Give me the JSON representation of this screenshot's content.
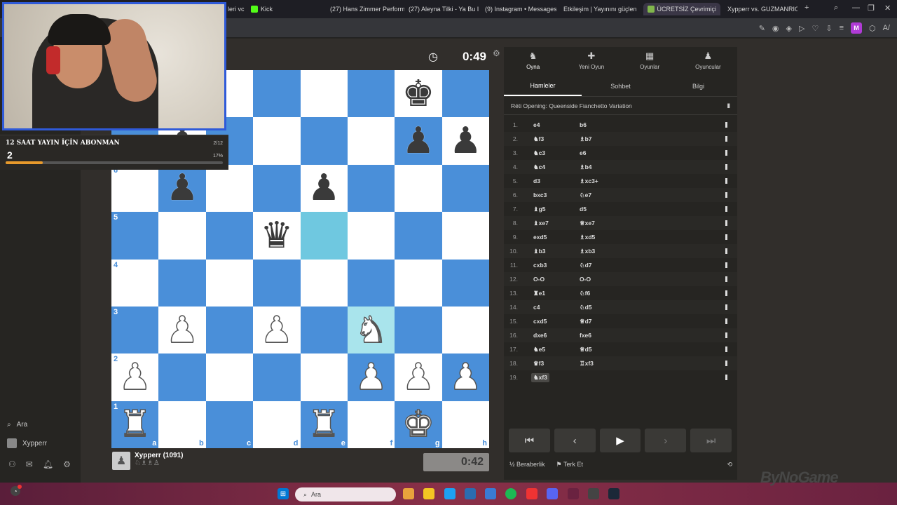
{
  "browser": {
    "tabs": [
      {
        "label": "leri vc",
        "color": "#6b6bff"
      },
      {
        "label": "Kick",
        "color": "#53fc18"
      },
      {
        "label": "(27) Hans Zimmer Perform",
        "color": "#ff0000"
      },
      {
        "label": "(27) Aleyna Tilki - Ya Bu I",
        "color": "#ff0000"
      },
      {
        "label": "(9) Instagram • Messages",
        "color": "#e1306c"
      },
      {
        "label": "Etkileşim | Yayınını güçlen",
        "color": "#ffffff"
      },
      {
        "label": "ÜCRETSİZ Çevrimiçi",
        "color": "#81b64c"
      },
      {
        "label": "Xypperr vs. GUZMANRICA",
        "color": "#81b64c"
      }
    ],
    "profile_initial": "M"
  },
  "stream": {
    "sub_goal_title": "12 SAAT YAYIN İÇİN ABONMAN",
    "sub_goal_count": "2",
    "sub_goal_progress": "2/12",
    "sub_goal_percent": "17%",
    "sub_goal_fraction": 0.17,
    "brand": "ByNoGame"
  },
  "sidebar": {
    "search_label": "Ara",
    "user_label": "Xypperr"
  },
  "game": {
    "top_clock": "0:49",
    "bottom_clock": "0:42",
    "player_name": "Xypperr (1091)",
    "player_captured": "♘♗♗♙",
    "files": [
      "a",
      "b",
      "c",
      "d",
      "e",
      "f",
      "g",
      "h"
    ],
    "ranks": [
      "6",
      "5",
      "4",
      "3",
      "2",
      "1"
    ],
    "board": [
      [
        "",
        "",
        "",
        "",
        "",
        "",
        "bK",
        ""
      ],
      [
        "",
        "bP",
        "",
        "",
        "",
        "",
        "bP",
        "bP"
      ],
      [
        "",
        "bP",
        "",
        "",
        "bP",
        "",
        "",
        ""
      ],
      [
        "",
        "",
        "",
        "bQ",
        "",
        "",
        "",
        ""
      ],
      [
        "",
        "",
        "",
        "",
        "",
        "",
        "",
        ""
      ],
      [
        "",
        "wP",
        "",
        "wP",
        "",
        "wN",
        "",
        ""
      ],
      [
        "wP",
        "",
        "",
        "",
        "",
        "wP",
        "wP",
        "wP"
      ],
      [
        "wR",
        "",
        "",
        "",
        "wR",
        "",
        "wK",
        ""
      ]
    ]
  },
  "panel": {
    "tabs": [
      {
        "label": "Oyna",
        "icon": "♞"
      },
      {
        "label": "Yeni Oyun",
        "icon": "✚"
      },
      {
        "label": "Oyunlar",
        "icon": "▦"
      },
      {
        "label": "Oyuncular",
        "icon": "♟"
      }
    ],
    "subtabs": [
      "Hamleler",
      "Sohbet",
      "Bilgi"
    ],
    "opening": "Réti Opening: Queenside Fianchetto Variation",
    "moves": [
      {
        "n": "1.",
        "w": "e4",
        "b": "b6"
      },
      {
        "n": "2.",
        "w": "♞f3",
        "b": "♗b7"
      },
      {
        "n": "3.",
        "w": "♞c3",
        "b": "e6"
      },
      {
        "n": "4.",
        "w": "♞c4",
        "b": "♗b4"
      },
      {
        "n": "5.",
        "w": "d3",
        "b": "♗xc3+"
      },
      {
        "n": "6.",
        "w": "bxc3",
        "b": "♘e7"
      },
      {
        "n": "7.",
        "w": "♝g5",
        "b": "d5"
      },
      {
        "n": "8.",
        "w": "♝xe7",
        "b": "♕xe7"
      },
      {
        "n": "9.",
        "w": "exd5",
        "b": "♗xd5"
      },
      {
        "n": "10.",
        "w": "♝b3",
        "b": "♗xb3"
      },
      {
        "n": "11.",
        "w": "cxb3",
        "b": "♘d7"
      },
      {
        "n": "12.",
        "w": "O-O",
        "b": "O-O"
      },
      {
        "n": "13.",
        "w": "♜e1",
        "b": "♘f6"
      },
      {
        "n": "14.",
        "w": "c4",
        "b": "♘d5"
      },
      {
        "n": "15.",
        "w": "cxd5",
        "b": "♕d7"
      },
      {
        "n": "16.",
        "w": "dxe6",
        "b": "fxe6"
      },
      {
        "n": "17.",
        "w": "♞e5",
        "b": "♕d5"
      },
      {
        "n": "18.",
        "w": "♛f3",
        "b": "♖xf3"
      },
      {
        "n": "19.",
        "w": "♞xf3",
        "b": ""
      }
    ],
    "draw_label": "Beraberlik",
    "resign_label": "Terk Et"
  }
}
